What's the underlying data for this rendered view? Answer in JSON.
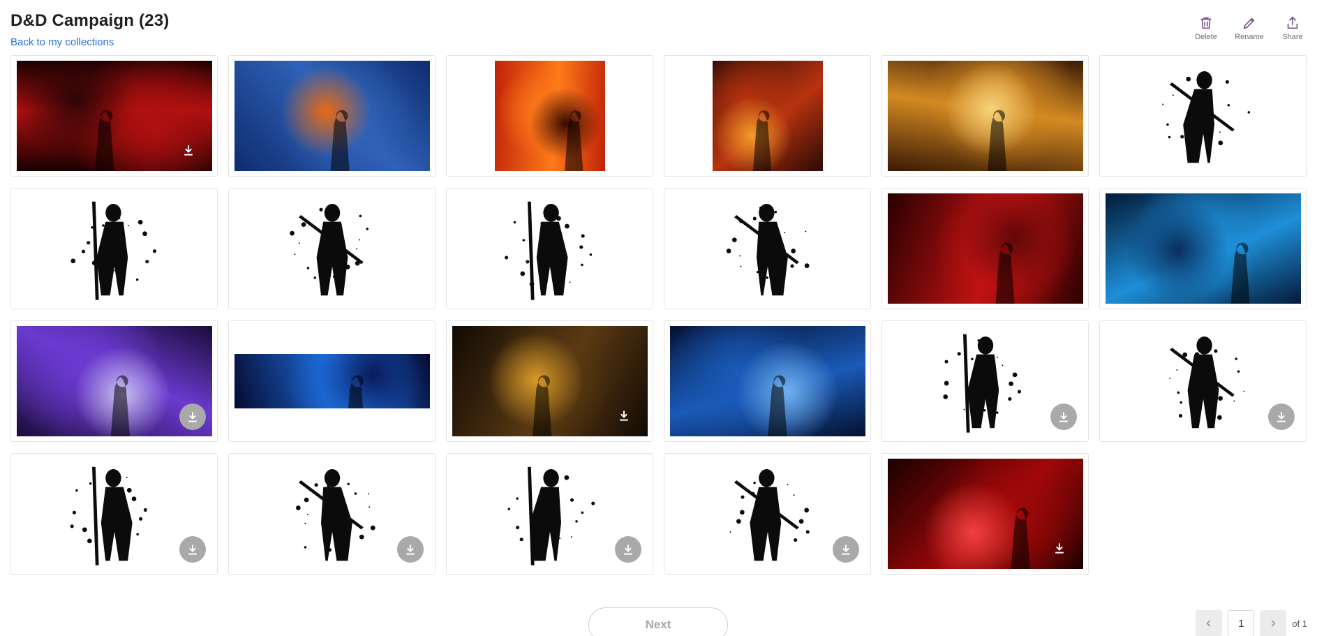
{
  "header": {
    "title": "D&D Campaign",
    "count": "(23)",
    "back_link": "Back to my collections"
  },
  "toolbar": [
    {
      "label": "Delete",
      "icon": "trash-icon"
    },
    {
      "label": "Rename",
      "icon": "pencil-icon"
    },
    {
      "label": "Share",
      "icon": "share-icon"
    }
  ],
  "items": [
    {
      "kind": "art",
      "shape": "wide",
      "palette": [
        "#1a0000",
        "#b01010",
        "#2b0505"
      ],
      "download": "plain"
    },
    {
      "kind": "art",
      "shape": "wide",
      "palette": [
        "#0e2c6e",
        "#2f62b8",
        "#e86a12"
      ],
      "download": "none"
    },
    {
      "kind": "art",
      "shape": "square",
      "palette": [
        "#c02208",
        "#ff7a1a",
        "#3a0a00"
      ],
      "download": "none"
    },
    {
      "kind": "art",
      "shape": "square",
      "palette": [
        "#2a0a05",
        "#b8330f",
        "#f59a2a"
      ],
      "download": "none"
    },
    {
      "kind": "art",
      "shape": "wide",
      "palette": [
        "#3a1a05",
        "#d48a22",
        "#f8d27a"
      ],
      "download": "none"
    },
    {
      "kind": "silhouette",
      "shape": "silhouette",
      "download": "none"
    },
    {
      "kind": "silhouette",
      "shape": "silhouette",
      "download": "none"
    },
    {
      "kind": "silhouette",
      "shape": "silhouette",
      "download": "none"
    },
    {
      "kind": "silhouette",
      "shape": "silhouette",
      "download": "none"
    },
    {
      "kind": "silhouette",
      "shape": "silhouette",
      "download": "none"
    },
    {
      "kind": "art",
      "shape": "wide",
      "palette": [
        "#2a0000",
        "#c01212",
        "#600808"
      ],
      "download": "none"
    },
    {
      "kind": "art",
      "shape": "wide",
      "palette": [
        "#041a38",
        "#1e8fd8",
        "#0a2f5e"
      ],
      "download": "none"
    },
    {
      "kind": "art",
      "shape": "wide",
      "palette": [
        "#1a0c3a",
        "#6b3ad0",
        "#c8c0f0"
      ],
      "download": "circle"
    },
    {
      "kind": "art",
      "shape": "banner",
      "palette": [
        "#050a30",
        "#1e6fe0",
        "#0a1a5a"
      ],
      "download": "none"
    },
    {
      "kind": "art",
      "shape": "wide",
      "palette": [
        "#120a04",
        "#5a3a12",
        "#d89a28"
      ],
      "download": "plain"
    },
    {
      "kind": "art",
      "shape": "wide",
      "palette": [
        "#041030",
        "#1a5ab8",
        "#6fb0f0"
      ],
      "download": "none"
    },
    {
      "kind": "silhouette",
      "shape": "silhouette",
      "download": "circle"
    },
    {
      "kind": "silhouette",
      "shape": "silhouette",
      "download": "circle"
    },
    {
      "kind": "silhouette",
      "shape": "silhouette",
      "download": "circle"
    },
    {
      "kind": "silhouette",
      "shape": "silhouette",
      "download": "circle"
    },
    {
      "kind": "silhouette",
      "shape": "silhouette",
      "download": "circle"
    },
    {
      "kind": "silhouette",
      "shape": "silhouette",
      "download": "circle"
    },
    {
      "kind": "art",
      "shape": "wide",
      "palette": [
        "#1a0000",
        "#a00808",
        "#f04040"
      ],
      "download": "plain"
    }
  ],
  "pagination": {
    "next_label": "Next",
    "current_page": "1",
    "of_label": "of 1"
  },
  "colors": {
    "link": "#2a6fdb",
    "download_circle": "#a9a9a9"
  }
}
